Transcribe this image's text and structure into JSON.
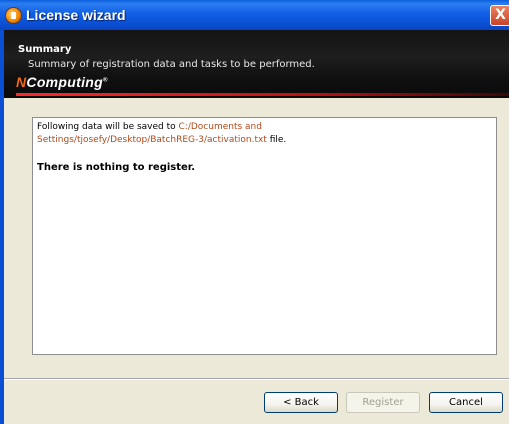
{
  "window": {
    "title": "License wizard",
    "close_glyph": "X"
  },
  "header": {
    "title": "Summary",
    "subtitle": "Summary of registration data and tasks to be performed.",
    "logo_prefix": "N",
    "logo_text": "Computing",
    "logo_mark": "®"
  },
  "content": {
    "line1_prefix": "Following data will be saved to ",
    "line1_path": "C:/Documents and",
    "line2_path": "Settings/tjosefy/Desktop/BatchREG-3/activation.txt",
    "line2_suffix": " file.",
    "message": "There is nothing to register."
  },
  "buttons": {
    "back": "< Back",
    "register": "Register",
    "cancel": "Cancel"
  },
  "colors": {
    "title_bar": "#0a4fd4",
    "path_text": "#b24a1a",
    "accent_red": "#ff2a2a"
  }
}
